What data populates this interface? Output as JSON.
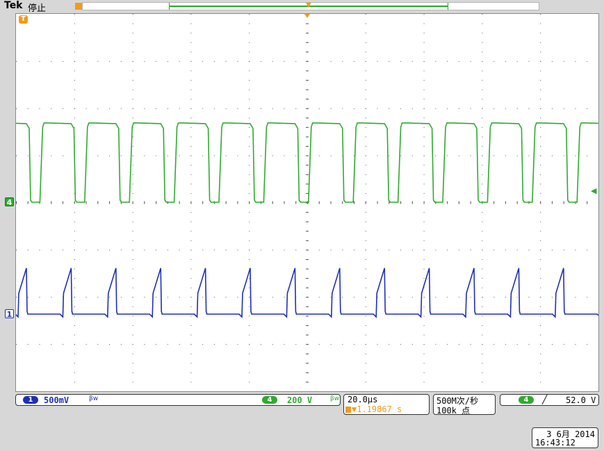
{
  "header": {
    "brand": "Tek",
    "status": "停止",
    "trigger_marker_label": "T"
  },
  "channels": {
    "ch1": {
      "badge": "1",
      "scale": "500mV",
      "bw_icon": "BW",
      "color": "#1e2fb6"
    },
    "ch4": {
      "badge": "4",
      "scale": "200 V",
      "bw_icon": "BW",
      "color": "#2faa2f"
    }
  },
  "timebase": {
    "scale": "20.0µs",
    "position": "▼1.19867 s",
    "position_icon": "trigger-position-icon"
  },
  "acquisition": {
    "sample_rate": "500M次/秒",
    "record_length": "100k 点"
  },
  "trigger": {
    "source_badge": "4",
    "slope_icon": "rising-edge-icon",
    "slope_glyph": "╱",
    "level": "52.0 V"
  },
  "timestamp": {
    "date": "3 6月 2014",
    "time": "16:43:12"
  },
  "colors": {
    "trigger": "#f39a1a",
    "ch1": "#1e2fb6",
    "ch4": "#2faa2f"
  },
  "chart_data": {
    "type": "line",
    "series": [
      {
        "channel": "4",
        "shape": "square",
        "period_us": 10,
        "high_div": 1.8,
        "low_div": 0
      },
      {
        "channel": "1",
        "shape": "sawtooth",
        "period_us": 10,
        "peak_div": 1.5,
        "baseline_div": 0
      }
    ],
    "grid": true,
    "divisions_x": 10,
    "divisions_y": 8
  }
}
